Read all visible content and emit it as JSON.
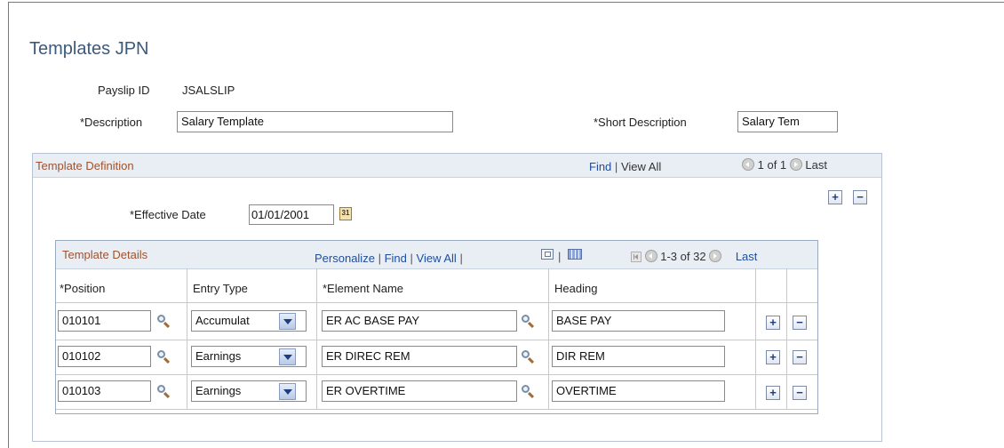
{
  "page": {
    "title": "Templates JPN"
  },
  "header": {
    "payslip_id_label": "Payslip ID",
    "payslip_id_value": "JSALSLIP",
    "description_label": "*Description",
    "description_value": "Salary Template",
    "short_description_label": "*Short Description",
    "short_description_value": "Salary Tem"
  },
  "template_definition": {
    "title": "Template Definition",
    "find": "Find",
    "separator": "|",
    "view_all": "View All",
    "counter": "1 of 1",
    "last": "Last",
    "effective_date_label": "*Effective Date",
    "effective_date_value": "01/01/2001"
  },
  "template_details": {
    "title": "Template Details",
    "personalize": "Personalize",
    "find": "Find",
    "view_all": "View All",
    "separator": "|",
    "counter": "1-3 of 32",
    "last": "Last",
    "columns": [
      "*Position",
      "Entry Type",
      "*Element Name",
      "Heading"
    ],
    "rows": [
      {
        "position": "010101",
        "entry_type": "Accumulat",
        "element_name": "ER AC BASE PAY",
        "heading": "BASE PAY"
      },
      {
        "position": "010102",
        "entry_type": "Earnings",
        "element_name": "ER DIREC REM",
        "heading": "DIR REM"
      },
      {
        "position": "010103",
        "entry_type": "Earnings",
        "element_name": "ER OVERTIME",
        "heading": "OVERTIME"
      }
    ]
  },
  "icons": {
    "add": "+",
    "remove": "−",
    "calendar": "31"
  },
  "colors": {
    "section_header_bg": "#e9eef5",
    "section_title": "#a0522d",
    "link": "#1f4ea0",
    "page_title": "#3c5a7a"
  }
}
